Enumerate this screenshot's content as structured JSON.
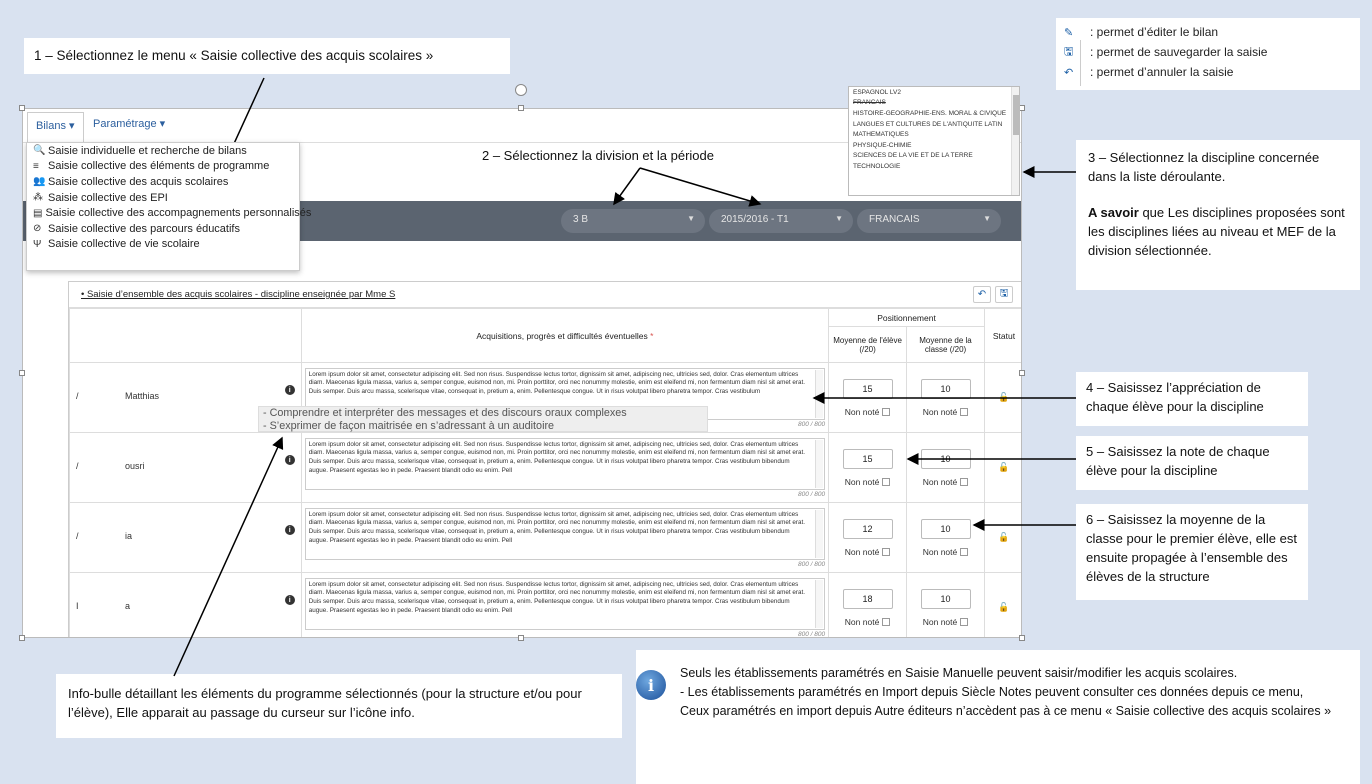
{
  "callouts": {
    "c1": "1 – Sélectionnez le menu « Saisie collective des acquis scolaires »",
    "c2": "2 – Sélectionnez la division et la période",
    "c3_line1": "3 – Sélectionnez la discipline concernée dans la liste déroulante.",
    "c3_bold": "A savoir",
    "c3_line2": " que Les disciplines proposées sont les disciplines liées au niveau et MEF de la division sélectionnée.",
    "c4": "4 – Saisissez l’appréciation de chaque élève pour la discipline",
    "c5": "5 – Saisissez la note de chaque élève pour la discipline",
    "c6": "6 – Saisissez la moyenne de la classe pour le premier élève, elle est ensuite propagée à l’ensemble des élèves de la structure",
    "c7": "Info-bulle détaillant les éléments du programme sélectionnés (pour la structure et/ou pour l’élève), Elle apparait au passage du curseur sur l’icône info."
  },
  "legend": [
    {
      "icon": "pencil-icon",
      "glyph": "✎",
      "text": ": permet d’éditer le bilan"
    },
    {
      "icon": "save-icon",
      "glyph": "🖫",
      "text": ": permet de sauvegarder la saisie"
    },
    {
      "icon": "undo-icon",
      "glyph": "↶",
      "text": ": permet d’annuler la saisie"
    }
  ],
  "navbar": {
    "bilans": "Bilans ▾",
    "parametrage": "Paramétrage ▾"
  },
  "menu": [
    {
      "icon": "search-icon",
      "glyph": "🔍",
      "label": "Saisie individuelle et recherche de bilans"
    },
    {
      "icon": "list-icon",
      "glyph": "≡",
      "label": "Saisie collective des éléments de programme"
    },
    {
      "icon": "group-icon",
      "glyph": "👥",
      "label": "Saisie collective des acquis scolaires"
    },
    {
      "icon": "cubes-icon",
      "glyph": "⁂",
      "label": "Saisie collective des EPI"
    },
    {
      "icon": "book-icon",
      "glyph": "▤",
      "label": "Saisie collective des accompagnements personnalisés"
    },
    {
      "icon": "compass-icon",
      "glyph": "⊘",
      "label": "Saisie collective des parcours éducatifs"
    },
    {
      "icon": "fork-icon",
      "glyph": "Ψ",
      "label": "Saisie collective de vie scolaire"
    }
  ],
  "selectors": {
    "division": "3 B",
    "periode": "2015/2016 - T1",
    "discipline": "FRANCAIS"
  },
  "disciplines": [
    "ESPAGNOL LV2",
    "FRANCAIS",
    "HISTOIRE-GEOGRAPHIE-ENS. MORAL & CIVIQUE",
    "LANGUES ET CULTURES DE L'ANTIQUITE LATIN",
    "MATHEMATIQUES",
    "PHYSIQUE-CHIMIE",
    "SCIENCES DE LA VIE ET DE LA TERRE",
    "TECHNOLOGIE"
  ],
  "panel": {
    "title": "• Saisie d’ensemble des acquis scolaires - discipline enseignée par Mme S",
    "positionnement": "Positionnement",
    "col_acq": "Acquisitions, progrès et difficultés éventuelles",
    "col_moy_eleve": "Moyenne de l'élève (/20)",
    "col_moy_classe": "Moyenne de la classe (/20)",
    "col_statut": "Statut",
    "non_note": "Non noté"
  },
  "tooltip": {
    "line1": "- Comprendre et interpréter des messages et des discours oraux complexes",
    "line2": "- S’exprimer de façon maitrisée en s’adressant à un auditoire"
  },
  "students": [
    {
      "initial": "/",
      "name": "Matthias",
      "text": "Lorem ipsum dolor sit amet, consectetur adipiscing elit. Sed non risus. Suspendisse lectus tortor, dignissim sit amet, adipiscing nec, ultricies sed, dolor. Cras elementum ultrices diam. Maecenas ligula massa, varius a, semper congue, euismod non, mi. Proin porttitor, orci nec nonummy molestie, enim est eleifend mi, non fermentum diam nisl sit amet erat. Duis semper. Duis arcu massa, scelerisque vitae, consequat in, pretium a, enim. Pellentesque congue. Ut in risus volutpat libero pharetra tempor. Cras vestibulum",
      "count": "800 / 800",
      "moy_eleve": "15",
      "moy_classe": "10"
    },
    {
      "initial": "/",
      "name": "ousri",
      "text": "Lorem ipsum dolor sit amet, consectetur adipiscing elit. Sed non risus. Suspendisse lectus tortor, dignissim sit amet, adipiscing nec, ultricies sed, dolor. Cras elementum ultrices diam. Maecenas ligula massa, varius a, semper congue, euismod non, mi. Proin porttitor, orci nec nonummy molestie, enim est eleifend mi, non fermentum diam nisl sit amet erat. Duis semper. Duis arcu massa, scelerisque vitae, consequat in, pretium a, enim. Pellentesque congue. Ut in risus volutpat libero pharetra tempor. Cras vestibulum bibendum augue. Praesent egestas leo in pede. Praesent blandit odio eu enim. Pell",
      "count": "800 / 800",
      "moy_eleve": "15",
      "moy_classe": "10"
    },
    {
      "initial": "/",
      "name": "ia",
      "text": "Lorem ipsum dolor sit amet, consectetur adipiscing elit. Sed non risus. Suspendisse lectus tortor, dignissim sit amet, adipiscing nec, ultricies sed, dolor. Cras elementum ultrices diam. Maecenas ligula massa, varius a, semper congue, euismod non, mi. Proin porttitor, orci nec nonummy molestie, enim est eleifend mi, non fermentum diam nisl sit amet erat. Duis semper. Duis arcu massa, scelerisque vitae, consequat in, pretium a, enim. Pellentesque congue. Ut in risus volutpat libero pharetra tempor. Cras vestibulum bibendum augue. Praesent egestas leo in pede. Praesent blandit odio eu enim. Pell",
      "count": "800 / 800",
      "moy_eleve": "12",
      "moy_classe": "10"
    },
    {
      "initial": "I",
      "name": "a",
      "text": "Lorem ipsum dolor sit amet, consectetur adipiscing elit. Sed non risus. Suspendisse lectus tortor, dignissim sit amet, adipiscing nec, ultricies sed, dolor. Cras elementum ultrices diam. Maecenas ligula massa, varius a, semper congue, euismod non, mi. Proin porttitor, orci nec nonummy molestie, enim est eleifend mi, non fermentum diam nisl sit amet erat. Duis semper. Duis arcu massa, scelerisque vitae, consequat in, pretium a, enim. Pellentesque congue. Ut in risus volutpat libero pharetra tempor. Cras vestibulum bibendum augue. Praesent egestas leo in pede. Praesent blandit odio eu enim. Pell",
      "count": "800 / 800",
      "moy_eleve": "18",
      "moy_classe": "10"
    }
  ],
  "note": {
    "l1": "Seuls les établissements paramétrés en Saisie Manuelle peuvent saisir/modifier les acquis scolaires.",
    "l2": "- Les établissements paramétrés en Import depuis Siècle Notes peuvent consulter ces données depuis ce menu,",
    "l3": "Ceux paramétrés en import depuis Autre éditeurs n’accèdent pas à ce menu « Saisie collective des acquis scolaires »"
  },
  "colors": {
    "background": "#d9e2f0",
    "greybar": "#5b6470",
    "link": "#2c5f9e",
    "lock": "#e8a000",
    "required": "#d9534f"
  }
}
